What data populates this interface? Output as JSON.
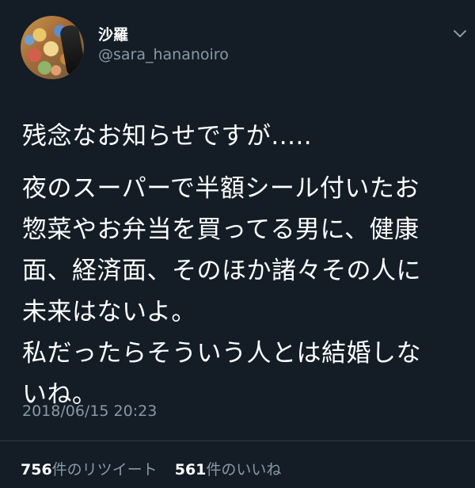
{
  "author": {
    "display_name": "沙羅",
    "username": "@sara_hananoiro"
  },
  "tweet": {
    "lines": [
      "残念なお知らせですが.....",
      "夜のスーパーで半額シール付いたお",
      "惣菜やお弁当を買ってる男に、健康",
      "面、経済面、そのほか諸々その人に",
      "未来はないよ。",
      "私だったらそういう人とは結婚しな",
      "いね。"
    ],
    "timestamp": "2018/06/15 20:23"
  },
  "stats": {
    "retweets_count": "756",
    "retweets_label": "件のリツイート",
    "likes_count": "561",
    "likes_label": "件のいいね"
  },
  "icons": {
    "menu": "chevron-down-icon"
  },
  "colors": {
    "background": "#141d26",
    "primary_text": "#ffffff",
    "secondary_text": "#8899a6",
    "divider": "#2d3b48"
  }
}
